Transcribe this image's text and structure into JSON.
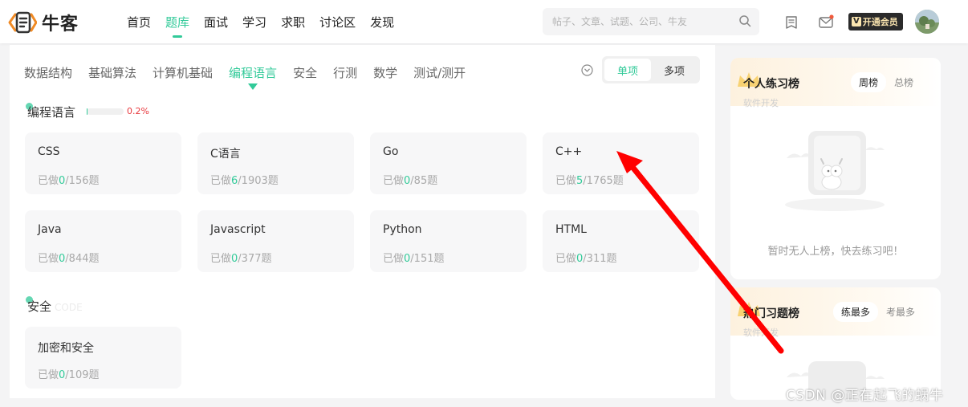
{
  "brand": {
    "name": "牛客"
  },
  "nav": [
    "首页",
    "题库",
    "面试",
    "学习",
    "求职",
    "讨论区",
    "发现"
  ],
  "search": {
    "placeholder": "帖子、文章、试题、公司、牛友"
  },
  "vip": {
    "badge": "V",
    "label": "开通会员"
  },
  "tabs": [
    "数据结构",
    "基础算法",
    "计算机基础",
    "编程语言",
    "安全",
    "行测",
    "数学",
    "测试/测开"
  ],
  "mode": {
    "single": "单项",
    "multi": "多项"
  },
  "sections": {
    "lang": {
      "title": "编程语言",
      "progress_pct": "0.2%",
      "progress_value": 0.002
    },
    "sec": {
      "title": "安全",
      "ghost": "CODE"
    }
  },
  "cards": [
    {
      "name": "CSS",
      "prefix": "已做",
      "done": "0",
      "suffix": "/156题"
    },
    {
      "name": "C语言",
      "prefix": "已做",
      "done": "6",
      "suffix": "/1903题"
    },
    {
      "name": "Go",
      "prefix": "已做",
      "done": "0",
      "suffix": "/85题"
    },
    {
      "name": "C++",
      "prefix": "已做",
      "done": "5",
      "suffix": "/1765题"
    },
    {
      "name": "Java",
      "prefix": "已做",
      "done": "0",
      "suffix": "/844题"
    },
    {
      "name": "Javascript",
      "prefix": "已做",
      "done": "0",
      "suffix": "/377题"
    },
    {
      "name": "Python",
      "prefix": "已做",
      "done": "0",
      "suffix": "/151题"
    },
    {
      "name": "HTML",
      "prefix": "已做",
      "done": "0",
      "suffix": "/311题"
    },
    {
      "name": "加密和安全",
      "prefix": "已做",
      "done": "0",
      "suffix": "/109题"
    }
  ],
  "rank1": {
    "title": "个人练习榜",
    "sub": "软件开发",
    "week": "周榜",
    "total": "总榜",
    "empty": "暂时无人上榜，快去练习吧！"
  },
  "rank2": {
    "title": "热门习题榜",
    "sub": "软件开发",
    "most_practiced": "练最多",
    "most_tested": "考最多"
  },
  "watermark": "CSDN @正在起飞的蜗牛",
  "colors": {
    "accent": "#32ca99",
    "annotation_arrow": "#ff0000",
    "progress_text": "#e8383d"
  }
}
